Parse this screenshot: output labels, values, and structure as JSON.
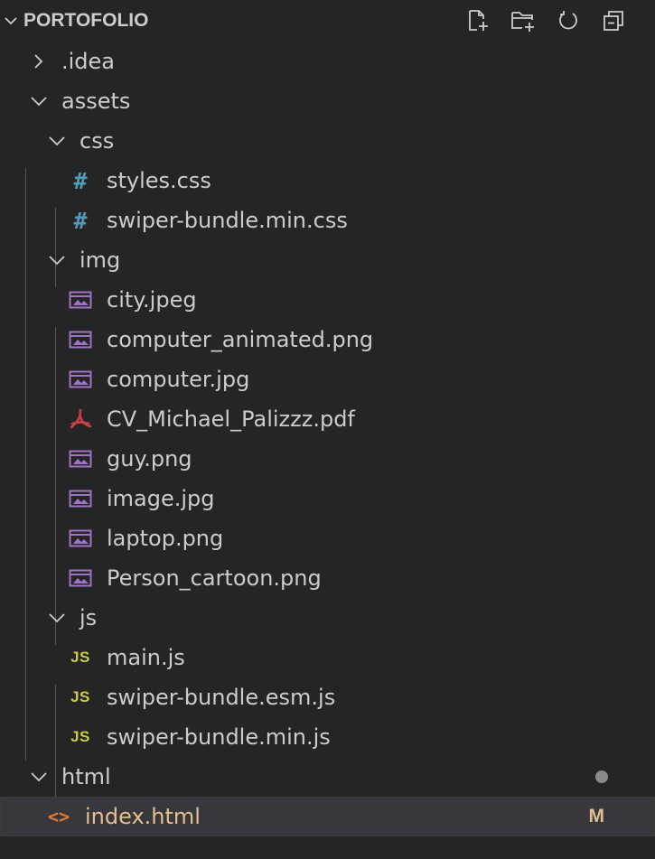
{
  "explorer": {
    "title": "PORTOFOLIO",
    "actions": [
      {
        "name": "new-file-icon"
      },
      {
        "name": "new-folder-icon"
      },
      {
        "name": "refresh-icon"
      },
      {
        "name": "collapse-all-icon"
      }
    ]
  },
  "tree": {
    "idea": ".idea",
    "assets": "assets",
    "css": "css",
    "css_files": [
      "styles.css",
      "swiper-bundle.min.css"
    ],
    "img": "img",
    "img_files": [
      "city.jpeg",
      "computer_animated.png",
      "computer.jpg",
      "CV_Michael_Palizzz.pdf",
      "guy.png",
      "image.jpg",
      "laptop.png",
      "Person_cartoon.png"
    ],
    "js": "js",
    "js_files": [
      "main.js",
      "swiper-bundle.esm.js",
      "swiper-bundle.min.js"
    ],
    "html": "html",
    "html_files": [
      "index.html"
    ],
    "css_icon_glyph": "#",
    "js_icon_glyph": "JS",
    "html_icon_glyph": "<>",
    "index_status": "M"
  },
  "colors": {
    "background": "#252526",
    "text": "#cccccc",
    "css_icon": "#519aba",
    "js_icon": "#cbcb41",
    "html_icon": "#e37933",
    "image_icon": "#a074c4",
    "pdf_icon": "#cc3e44",
    "modified": "#e2c08d"
  }
}
